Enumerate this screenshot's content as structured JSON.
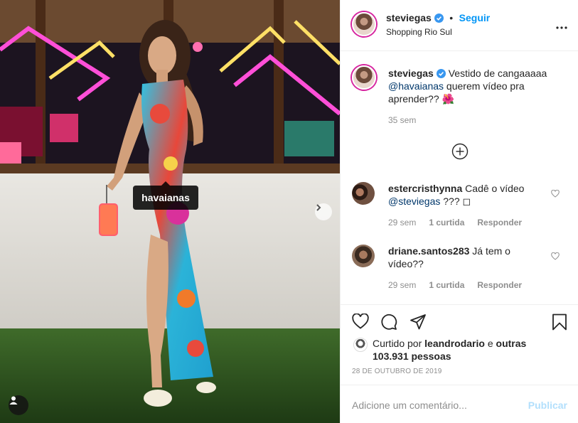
{
  "post": {
    "author": "steviegas",
    "follow_label": "Seguir",
    "separator": "•",
    "location": "Shopping Rio Sul",
    "more_label": "•••",
    "photo_tag": "havaianas"
  },
  "caption": {
    "author": "steviegas",
    "text_before": " Vestido de cangaaaaa ",
    "mention": "@havaianas",
    "text_after": " querem vídeo pra aprender?? 🌺",
    "time": "35 sem"
  },
  "comments": [
    {
      "author": "estercristhynna",
      "text": " Cadê o vídeo ",
      "mention": "@steviegas",
      "text_after": " ??? ◻",
      "time": "29 sem",
      "likes": "1 curtida",
      "reply": "Responder"
    },
    {
      "author": "driane.santos283",
      "text": " Já tem o vídeo??",
      "time": "29 sem",
      "likes": "1 curtida",
      "reply": "Responder"
    }
  ],
  "likes": {
    "prefix": "Curtido por ",
    "first_user": "leandrodario",
    "middle": " e ",
    "others": "outras 103.931 pessoas"
  },
  "date": "28 DE OUTUBRO DE 2019",
  "comment_box": {
    "placeholder": "Adicione um comentário...",
    "publish_label": "Publicar"
  },
  "colors": {
    "link_blue": "#0095f6",
    "mention_blue": "#00376b",
    "publish_disabled": "#b2dffc",
    "neon_pink": "#ff4fd8",
    "neon_yellow": "#ffe066"
  }
}
